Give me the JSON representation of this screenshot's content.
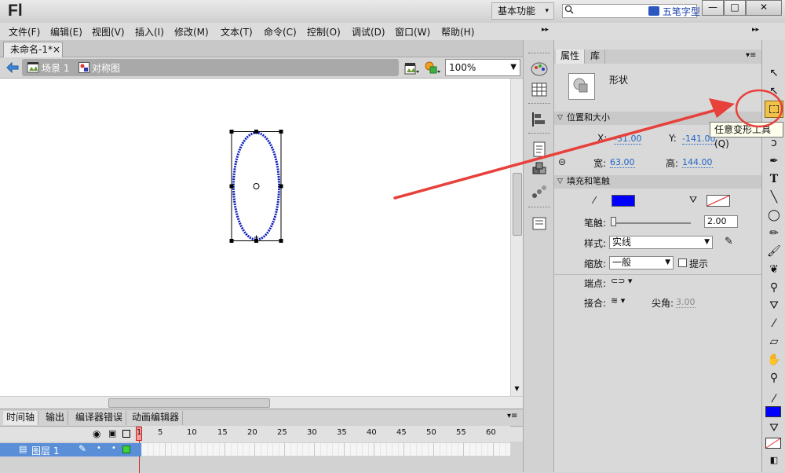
{
  "app": {
    "logo": "Fl",
    "workspace": "基本功能",
    "search_placeholder": "",
    "ime_label": "五笔字型",
    "window_buttons": [
      "—",
      "□",
      "✕"
    ]
  },
  "menu": [
    "文件(F)",
    "编辑(E)",
    "视图(V)",
    "插入(I)",
    "修改(M)",
    "文本(T)",
    "命令(C)",
    "控制(O)",
    "调试(D)",
    "窗口(W)",
    "帮助(H)"
  ],
  "document": {
    "tab_title": "未命名-1*",
    "tab_close": "×",
    "breadcrumb": [
      "场景 1",
      "对称图"
    ],
    "zoom": "100%"
  },
  "timeline": {
    "tabs": [
      "时间轴",
      "输出",
      "编译器错误",
      "动画编辑器"
    ],
    "frame_numbers": [
      "1",
      "5",
      "10",
      "15",
      "20",
      "25",
      "30",
      "35",
      "40",
      "45",
      "50",
      "55",
      "60"
    ],
    "layer_name": "图层 1"
  },
  "properties": {
    "tabs": [
      "属性",
      "库"
    ],
    "object_type": "形状",
    "section_position": "位置和大小",
    "x_label": "X:",
    "x_value": "-31.00",
    "y_label": "Y:",
    "y_value": "-141.00",
    "width_label": "宽:",
    "width_value": "63.00",
    "height_label": "高:",
    "height_value": "144.00",
    "section_fill": "填充和笔触",
    "stroke_color": "#0000ff",
    "stroke_label": "笔触:",
    "stroke_value": "2.00",
    "style_label": "样式:",
    "style_value": "实线",
    "scale_label": "缩放:",
    "scale_value": "一般",
    "hint_label": "提示",
    "cap_label": "端点:",
    "join_label": "接合:",
    "miter_label": "尖角:",
    "miter_value": "3.00"
  },
  "tooltip": "任意变形工具(Q)",
  "colors": {
    "accent_blue": "#0000ff",
    "annotation_red": "#e8403a",
    "layer_highlight": "#5a8fd8"
  }
}
